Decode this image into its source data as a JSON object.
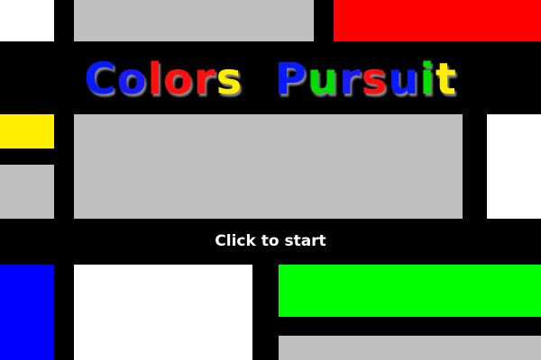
{
  "title": {
    "letters": [
      {
        "char": "C",
        "color": "#0a1aff"
      },
      {
        "char": "o",
        "color": "#1a1aff"
      },
      {
        "char": "l",
        "color": "#ff1010"
      },
      {
        "char": "o",
        "color": "#ff1010"
      },
      {
        "char": "r",
        "color": "#ff1010"
      },
      {
        "char": "s",
        "color": "#ffee00"
      },
      {
        "char": " ",
        "color": "#000000"
      },
      {
        "char": " ",
        "color": "#000000"
      },
      {
        "char": "P",
        "color": "#0a1aff"
      },
      {
        "char": "u",
        "color": "#00e000"
      },
      {
        "char": "r",
        "color": "#1a1aff"
      },
      {
        "char": "s",
        "color": "#ff1010"
      },
      {
        "char": "u",
        "color": "#0a1aff"
      },
      {
        "char": "i",
        "color": "#00e000"
      },
      {
        "char": "t",
        "color": "#ffee00"
      }
    ]
  },
  "start_label": "Click to start",
  "palette": {
    "background": "#000000",
    "white": "#ffffff",
    "gray": "#c0c0c0",
    "red": "#ff0000",
    "yellow": "#ffee00",
    "blue": "#0000ff",
    "green": "#00ff00"
  }
}
